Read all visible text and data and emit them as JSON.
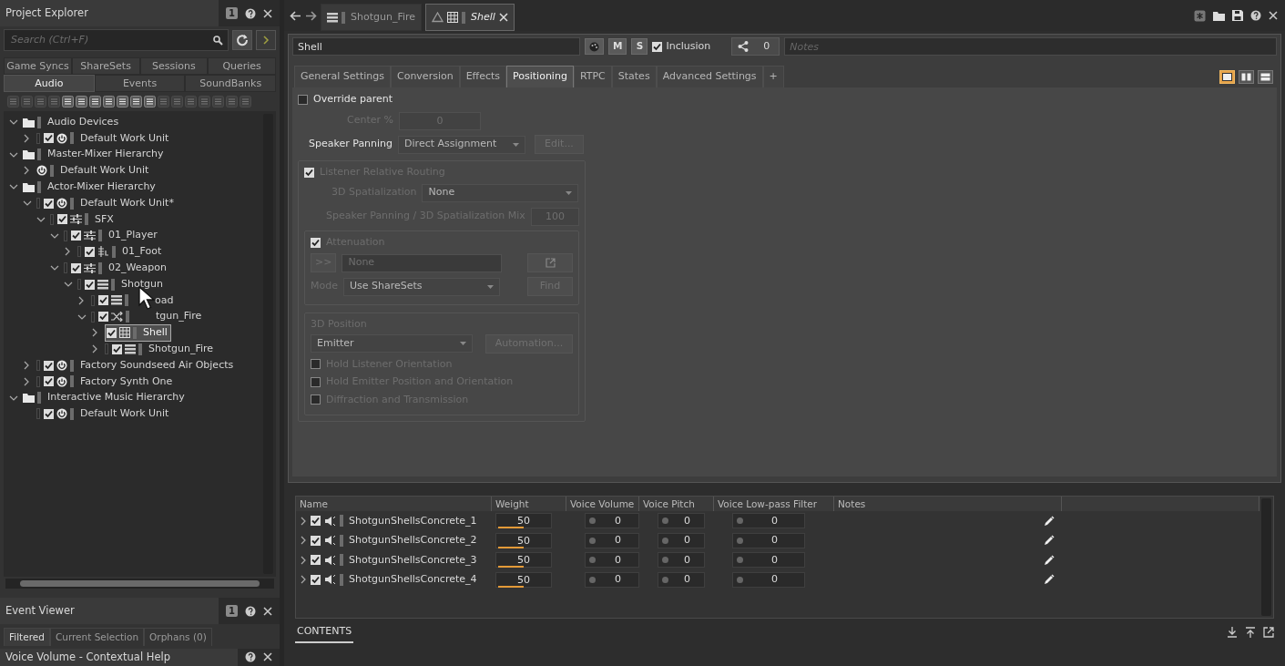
{
  "project_explorer": {
    "title": "Project Explorer",
    "badge": "1",
    "search": {
      "placeholder": "Search (Ctrl+F)"
    },
    "tab_rows": [
      {
        "tabs": [
          {
            "label": "Game Syncs",
            "selected": false
          },
          {
            "label": "ShareSets",
            "selected": false
          },
          {
            "label": "Sessions",
            "selected": false
          },
          {
            "label": "Queries",
            "selected": false
          }
        ]
      },
      {
        "tabs": [
          {
            "label": "Audio",
            "selected": true
          },
          {
            "label": "Events",
            "selected": false
          },
          {
            "label": "SoundBanks",
            "selected": false
          }
        ]
      }
    ],
    "tree": [
      {
        "label": "Audio Devices",
        "kind": "folder",
        "expanded": true,
        "selected": false,
        "children": [
          {
            "label": "Default Work Unit",
            "kind": "work_unit",
            "expanded": false,
            "checked": true,
            "selected": false
          }
        ]
      },
      {
        "label": "Master-Mixer Hierarchy",
        "kind": "folder",
        "expanded": true,
        "selected": false,
        "children": [
          {
            "label": "Default Work Unit",
            "kind": "work_unit",
            "expanded": false,
            "selected": false
          }
        ]
      },
      {
        "label": "Actor-Mixer Hierarchy",
        "kind": "folder",
        "expanded": true,
        "selected": false,
        "children": [
          {
            "label": "Default Work Unit*",
            "kind": "work_unit",
            "expanded": true,
            "checked": true,
            "selected": false,
            "children": [
              {
                "label": "SFX",
                "kind": "actor_mixer",
                "expanded": true,
                "checked": true,
                "selected": false,
                "children": [
                  {
                    "label": "01_Player",
                    "kind": "actor_mixer",
                    "expanded": true,
                    "checked": true,
                    "selected": false,
                    "children": [
                      {
                        "label": "01_Foot",
                        "kind": "switch",
                        "expanded": false,
                        "checked": true,
                        "selected": false
                      }
                    ]
                  },
                  {
                    "label": "02_Weapon",
                    "kind": "actor_mixer",
                    "expanded": true,
                    "checked": true,
                    "selected": false,
                    "children": [
                      {
                        "label": "Shotgun",
                        "kind": "sequence",
                        "expanded": true,
                        "checked": true,
                        "selected": false,
                        "children": [
                          {
                            "label": "oad",
                            "kind": "sequence",
                            "expanded": false,
                            "checked": true,
                            "selected": false,
                            "covered": true
                          },
                          {
                            "label": "tgun_Fire",
                            "kind": "random",
                            "expanded": true,
                            "checked": true,
                            "selected": false,
                            "covered": true,
                            "children": [
                              {
                                "label": "Shell",
                                "kind": "blend",
                                "expanded": false,
                                "checked": true,
                                "selected": true
                              },
                              {
                                "label": "Shotgun_Fire",
                                "kind": "sequence",
                                "expanded": false,
                                "checked": true,
                                "selected": false
                              }
                            ]
                          }
                        ]
                      }
                    ]
                  }
                ]
              }
            ]
          },
          {
            "label": "Factory Soundseed Air Objects",
            "kind": "work_unit",
            "expanded": false,
            "checked": true,
            "selected": false
          },
          {
            "label": "Factory Synth One",
            "kind": "work_unit",
            "expanded": false,
            "checked": true,
            "selected": false
          }
        ]
      },
      {
        "label": "Interactive Music Hierarchy",
        "kind": "folder",
        "expanded": true,
        "selected": false,
        "children": [
          {
            "label": "Default Work Unit",
            "kind": "work_unit",
            "checked": true,
            "selected": false
          }
        ]
      }
    ]
  },
  "event_viewer": {
    "title": "Event Viewer",
    "badge": "1",
    "tabs": [
      {
        "label": "Filtered",
        "selected": true
      },
      {
        "label": "Current Selection",
        "selected": false
      },
      {
        "label": "Orphans (0)",
        "selected": false
      }
    ]
  },
  "contextual_help": {
    "title": "Voice Volume - Contextual Help"
  },
  "editor": {
    "tabs": [
      {
        "label": "Shotgun_Fire",
        "kind": "sequence",
        "selected": false
      },
      {
        "label": "Shell",
        "kind": "blend",
        "selected": true
      }
    ],
    "object_name": "Shell",
    "mute_label": "M",
    "solo_label": "S",
    "inclusion": {
      "label": "Inclusion",
      "checked": true
    },
    "references": "0",
    "notes": {
      "placeholder": "Notes"
    },
    "property_tabs": [
      {
        "label": "General Settings",
        "selected": false
      },
      {
        "label": "Conversion",
        "selected": false
      },
      {
        "label": "Effects",
        "selected": false
      },
      {
        "label": "Positioning",
        "selected": true
      },
      {
        "label": "RTPC",
        "selected": false
      },
      {
        "label": "States",
        "selected": false
      },
      {
        "label": "Advanced Settings",
        "selected": false
      }
    ],
    "add_tab": "+",
    "layout_modes": [
      {
        "kind": "single",
        "selected": true
      },
      {
        "kind": "columns",
        "selected": false
      },
      {
        "kind": "rows",
        "selected": false
      }
    ],
    "positioning": {
      "disabled": true,
      "override_parent": {
        "label": "Override parent",
        "checked": false
      },
      "center": {
        "label": "Center %",
        "value": "0"
      },
      "speaker_panning": {
        "label": "Speaker Panning",
        "value": "Direct Assignment",
        "button": "Edit..."
      },
      "listener_routing": {
        "label": "Listener Relative Routing",
        "checked": true,
        "spatialization": {
          "label": "3D Spatialization",
          "value": "None"
        },
        "mix": {
          "label": "Speaker Panning / 3D Spatialization Mix",
          "value": "100"
        },
        "attenuation": {
          "label": "Attenuation",
          "checked": true,
          "expand_button": ">>",
          "value": "None",
          "mode_label": "Mode",
          "mode": "Use ShareSets",
          "find_button": "Find"
        },
        "position": {
          "title": "3D Position",
          "value": "Emitter",
          "button": "Automation...",
          "options": [
            {
              "label": "Hold Listener Orientation",
              "checked": false
            },
            {
              "label": "Hold Emitter Position and Orientation",
              "checked": false
            },
            {
              "label": "Diffraction and Transmission",
              "checked": false
            }
          ]
        }
      }
    }
  },
  "contents": {
    "columns": [
      "Name",
      "Weight",
      "Voice Volume",
      "Voice Pitch",
      "Voice Low-pass Filter",
      "Notes"
    ],
    "rows": [
      {
        "name": "ShotgunShellsConcrete_1",
        "checked": true,
        "weight": {
          "value": "50",
          "level": 0.5
        },
        "voice_volume": "0",
        "voice_pitch": "0",
        "voice_lowpass": "0"
      },
      {
        "name": "ShotgunShellsConcrete_2",
        "checked": true,
        "weight": {
          "value": "50",
          "level": 0.5
        },
        "voice_volume": "0",
        "voice_pitch": "0",
        "voice_lowpass": "0"
      },
      {
        "name": "ShotgunShellsConcrete_3",
        "checked": true,
        "weight": {
          "value": "50",
          "level": 0.5
        },
        "voice_volume": "0",
        "voice_pitch": "0",
        "voice_lowpass": "0"
      },
      {
        "name": "ShotgunShellsConcrete_4",
        "checked": true,
        "weight": {
          "value": "50",
          "level": 0.5
        },
        "voice_volume": "0",
        "voice_pitch": "0",
        "voice_lowpass": "0"
      }
    ],
    "footer_tab": "CONTENTS"
  }
}
